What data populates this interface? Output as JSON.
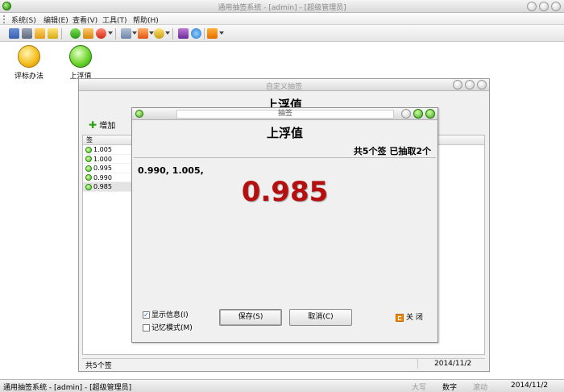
{
  "app": {
    "title": "通用抽签系统 - [admin] - [超级管理员]"
  },
  "menu": [
    "系统(S)",
    "编辑(E)",
    "查看(V)",
    "工具(T)",
    "帮助(H)"
  ],
  "desktop_icons": [
    {
      "label": "评标办法",
      "color": "yellow"
    },
    {
      "label": "上浮值",
      "color": "green"
    }
  ],
  "status": {
    "left": "通用抽签系统 - [admin] - [超级管理员]",
    "caps": "大写",
    "num": "数字",
    "scroll": "滚动",
    "date": "2014/11/2"
  },
  "back_dialog": {
    "title": "自定义抽签",
    "heading": "上浮值",
    "add_label": "增加",
    "list_header": "签",
    "items": [
      "1.005",
      "1.000",
      "0.995",
      "0.990",
      "0.985"
    ],
    "selected_index": 4,
    "footer_count": "共5个签",
    "footer_date": "2014/11/2"
  },
  "front_dialog": {
    "title": "抽签",
    "heading": "上浮值",
    "summary": "共5个签 已抽取2个",
    "drawn": "0.990, 1.005,",
    "current_value": "0.985",
    "show_info_label": "显示信息(I)",
    "show_info_checked": true,
    "memory_mode_label": "记忆模式(M)",
    "memory_mode_checked": false,
    "save_label": "保存(S)",
    "cancel_label": "取消(C)",
    "close_label": "关 闭"
  }
}
